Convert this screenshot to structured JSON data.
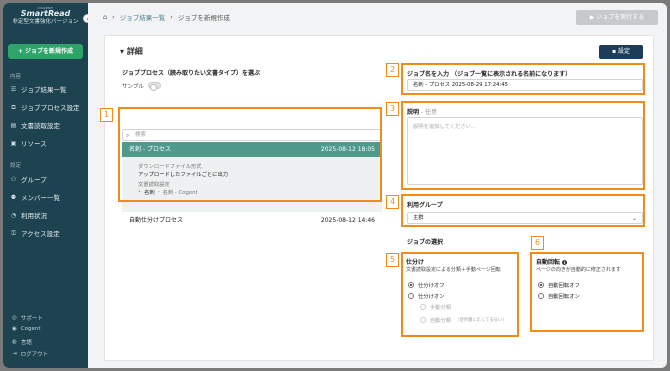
{
  "sidebar": {
    "brand_small": "COGENT",
    "brand": "SmartRead",
    "brand_sub": "非定型文書強化バージョン",
    "new_job": "+ ジョブを新規作成",
    "section_content": "内容",
    "items": [
      {
        "label": "ジョブ結果一覧",
        "icon": "list-icon"
      },
      {
        "label": "ジョブプロセス設定",
        "icon": "process-icon"
      },
      {
        "label": "文書読取設定",
        "icon": "document-icon"
      },
      {
        "label": "リソース",
        "icon": "folder-icon"
      }
    ],
    "section_settings": "設定",
    "settings_items": [
      {
        "label": "グループ",
        "icon": "group-icon"
      },
      {
        "label": "メンバー一覧",
        "icon": "members-icon"
      },
      {
        "label": "利用状況",
        "icon": "usage-icon"
      },
      {
        "label": "アクセス設定",
        "icon": "lock-icon"
      }
    ],
    "footer": [
      {
        "label": "サポート",
        "icon": "support-icon"
      },
      {
        "label": "Cogent",
        "icon": "user-icon"
      },
      {
        "label": "言語",
        "icon": "globe-icon"
      },
      {
        "label": "ログアウト",
        "icon": "logout-icon"
      }
    ]
  },
  "topbar": {
    "breadcrumb": [
      "ジョブ結果一覧",
      "ジョブを新規作成"
    ],
    "run_button": "▶ ジョブを実行する"
  },
  "card": {
    "title": "詳細",
    "settings_button": "設定",
    "process_section_label": "ジョブプロセス（読み取りたい文書タイプ）を選ぶ",
    "sample_label": "サンプル",
    "search_placeholder": "検索",
    "selected_process": {
      "name": "名刺 - プロセス",
      "date": "2025-08-12 18:05"
    },
    "detail": {
      "download_label": "ダウンロードファイル形式",
      "download_value": "アップロードしたファイルごとに出力",
      "reading_label": "文書読取設定",
      "reading_value_1": "名刺",
      "reading_value_2": "名刺 - Cogent"
    },
    "second_process": {
      "name": "自動仕分けプロセス",
      "date": "2025-08-12 14:46"
    },
    "job_name_label": "ジョブ名を入力 （ジョブ一覧に表示される名前になります）",
    "job_name_value": "名刺 - プロセス 2025-08-29 17:24:45",
    "description_label": "説明",
    "description_optional": " - 任意",
    "description_placeholder": "説明を追加してください...",
    "group_label": "利用グループ",
    "group_value": "主群",
    "job_select_label": "ジョブの選択",
    "sort_label": "仕分け",
    "sort_desc": "文書読取設定による分類＋手動ページ回転",
    "sort_off": "仕分けオフ",
    "sort_on": "仕分けオン",
    "manual_sort": "手動分類",
    "auto_sort": "自動分類",
    "auto_sort_hint": "（使用量に応じて支払い）",
    "rotate_label": "自動回転",
    "rotate_desc": "ページの向きが自動的に修正されます",
    "rotate_off": "自動回転オフ",
    "rotate_on": "自動回転オン"
  },
  "annotations": [
    "1",
    "2",
    "3",
    "4",
    "5",
    "6"
  ],
  "colors": {
    "sidebar": "#1d4250",
    "accent_green": "#2ea46a",
    "selected_row": "#4f9a8a",
    "highlight": "#f08c1c"
  }
}
